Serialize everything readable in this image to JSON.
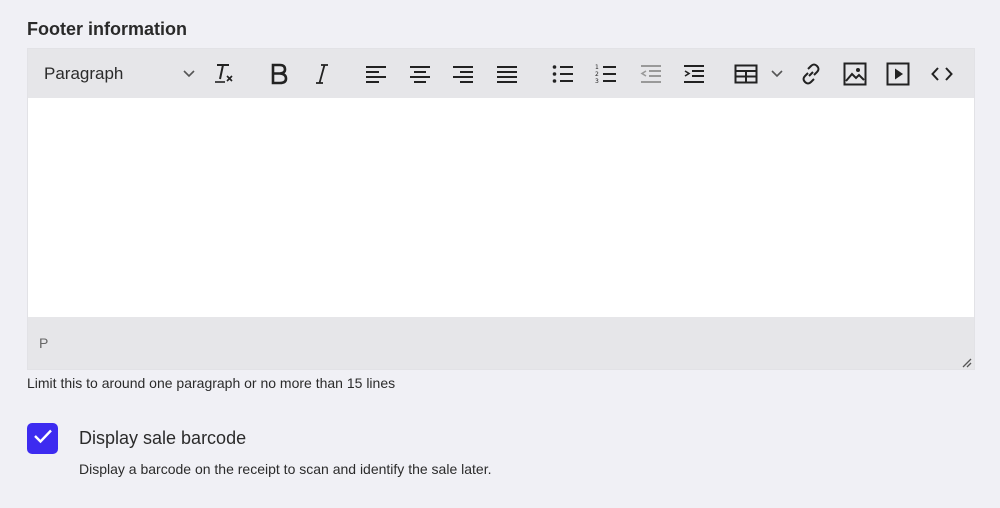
{
  "section": {
    "title": "Footer information"
  },
  "toolbar": {
    "format_select_value": "Paragraph",
    "buttons": [
      "clear-formatting-icon",
      "bold-icon",
      "italic-icon",
      "align-left-icon",
      "align-center-icon",
      "align-right-icon",
      "align-justify-icon",
      "bullet-list-icon",
      "numbered-list-icon",
      "outdent-icon",
      "indent-icon",
      "table-icon",
      "link-icon",
      "image-icon",
      "media-icon",
      "source-code-icon"
    ]
  },
  "editor": {
    "content": "",
    "path": "P"
  },
  "helper_text": "Limit this to around one paragraph or no more than 15 lines",
  "barcode_option": {
    "label": "Display sale barcode",
    "description": "Display a barcode on the receipt to scan and identify the sale later.",
    "checked": true,
    "accent_color": "#3d2bf0"
  }
}
